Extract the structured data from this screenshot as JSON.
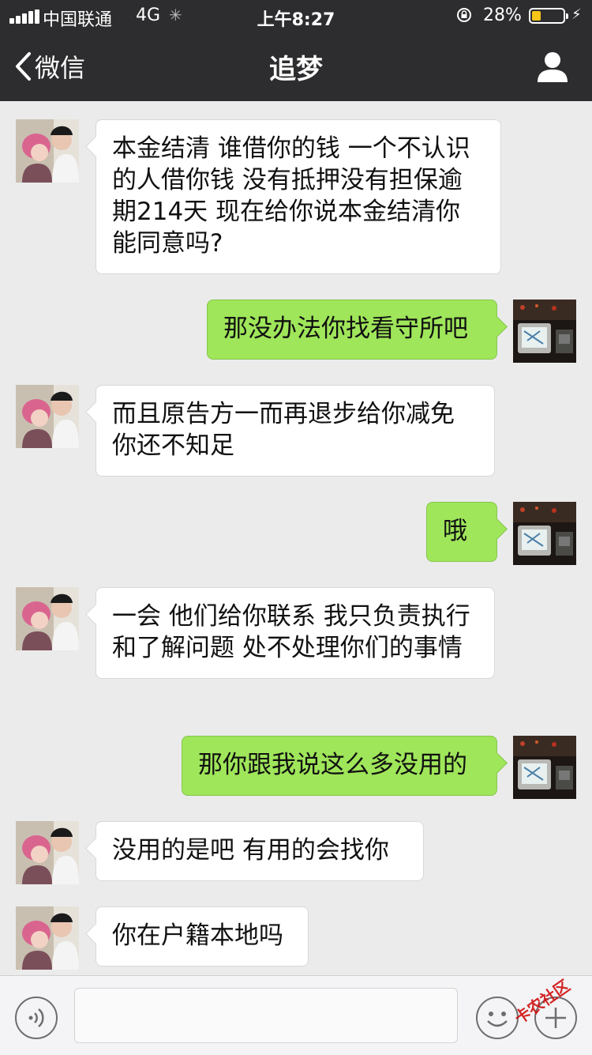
{
  "status_bar": {
    "carrier": "中国联通",
    "network": "4G",
    "time": "上午8:27",
    "battery_percent": "28%",
    "battery_level": 0.28,
    "battery_color": "#f5c518"
  },
  "nav": {
    "back_label": "微信",
    "title": "追梦",
    "profile_icon": "person-icon"
  },
  "messages": [
    {
      "side": "in",
      "text": "本金结清 谁借你的钱 一个不认识的人借你钱 没有抵押没有担保逾期214天 现在给你说本金结清你能同意吗?"
    },
    {
      "side": "out",
      "text": "那没办法你找看守所吧"
    },
    {
      "side": "in",
      "text": "而且原告方一而再退步给你减免你还不知足"
    },
    {
      "side": "out",
      "text": "哦"
    },
    {
      "side": "in",
      "text": "一会 他们给你联系 我只负责执行和了解问题 处不处理你们的事情"
    },
    {
      "side": "out",
      "text": "那你跟我说这么多没用的"
    },
    {
      "side": "in",
      "text": "没用的是吧 有用的会找你"
    },
    {
      "side": "in",
      "text": "你在户籍本地吗"
    }
  ],
  "input_bar": {
    "voice_icon": "voice-icon",
    "emoji_icon": "emoji-icon",
    "plus_icon": "plus-icon",
    "input_value": ""
  },
  "watermark": "卡农社区",
  "colors": {
    "nav_bg": "#2d2d2f",
    "chat_bg": "#ebebeb",
    "outgoing_bubble": "#9fe65a",
    "incoming_bubble": "#ffffff"
  }
}
